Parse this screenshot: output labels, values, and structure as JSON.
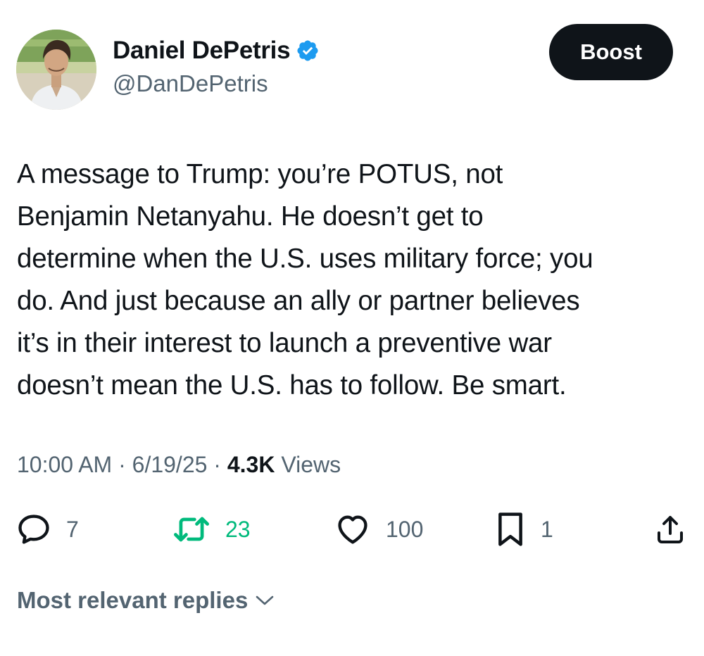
{
  "author": {
    "display_name": "Daniel DePetris",
    "handle": "@DanDePetris",
    "verified": true
  },
  "header": {
    "boost_label": "Boost"
  },
  "tweet": {
    "lines": [
      "A message to Trump: you’re POTUS, not",
      "Benjamin Netanyahu. He doesn’t get to",
      "determine when the U.S. uses military force; you",
      "do. And just because an ally or partner believes",
      "it’s in their interest to launch a preventive war",
      "doesn’t mean the U.S. has to follow. Be smart."
    ]
  },
  "meta": {
    "time": "10:00 AM",
    "separator": "·",
    "date": "6/19/25",
    "views_count": "4.3K",
    "views_label": "Views"
  },
  "actions": {
    "replies": "7",
    "reposts": "23",
    "likes": "100",
    "bookmarks": "1"
  },
  "replies_sort": {
    "label": "Most relevant replies"
  },
  "colors": {
    "text_primary": "#0f1419",
    "text_secondary": "#536471",
    "verified_blue": "#1d9bf0",
    "repost_green": "#00ba7c",
    "button_dark": "#0f1419"
  },
  "icons": {
    "verified": "verified-badge-icon",
    "reply": "speech-bubble-icon",
    "repost": "repost-arrows-icon",
    "like": "heart-icon",
    "bookmark": "bookmark-icon",
    "share": "share-upload-icon",
    "sort": "chevron-down-icon"
  }
}
